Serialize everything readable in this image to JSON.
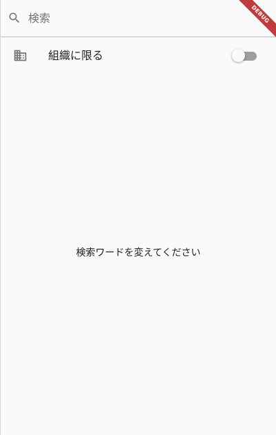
{
  "search": {
    "placeholder": "検索",
    "value": ""
  },
  "org_filter": {
    "label": "組織に限る",
    "enabled": false
  },
  "empty_state": {
    "message": "検索ワードを変えてください"
  },
  "debug_banner": {
    "label": "DEBUG",
    "color": "#b71c1c"
  },
  "icons": {
    "search": "search-icon",
    "organization": "building-icon"
  }
}
